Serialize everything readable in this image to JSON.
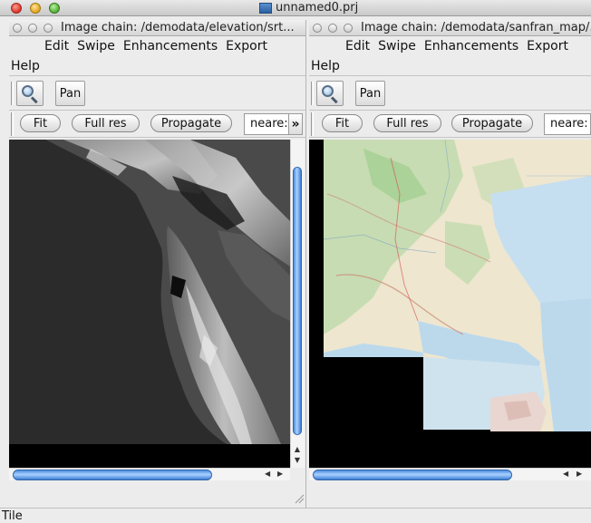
{
  "window": {
    "title": "unnamed0.prj"
  },
  "left_panel": {
    "title": "Image chain: /demodata/elevation/srt...",
    "menus": [
      "Edit",
      "Swipe",
      "Enhancements",
      "Export"
    ],
    "help": "Help",
    "toolbar": {
      "zoom_icon": "magnifier-icon",
      "pan_label": "Pan"
    },
    "buttons": {
      "fit": "Fit",
      "full_res": "Full res",
      "propagate": "Propagate",
      "resample": "neare:",
      "more": "»"
    }
  },
  "right_panel": {
    "title": "Image chain: /demodata/sanfran_map/.",
    "menus": [
      "Edit",
      "Swipe",
      "Enhancements",
      "Export"
    ],
    "help": "Help",
    "toolbar": {
      "zoom_icon": "magnifier-icon",
      "pan_label": "Pan"
    },
    "buttons": {
      "fit": "Fit",
      "full_res": "Full res",
      "propagate": "Propagate",
      "resample": "neare:"
    }
  },
  "status": {
    "text": "Tile"
  },
  "colors": {
    "scroll_thumb": "#6aa6ee",
    "map_water": "#bcd9ec",
    "map_land": "#efe8d4",
    "elevation_bg": "#2d2d2d"
  }
}
